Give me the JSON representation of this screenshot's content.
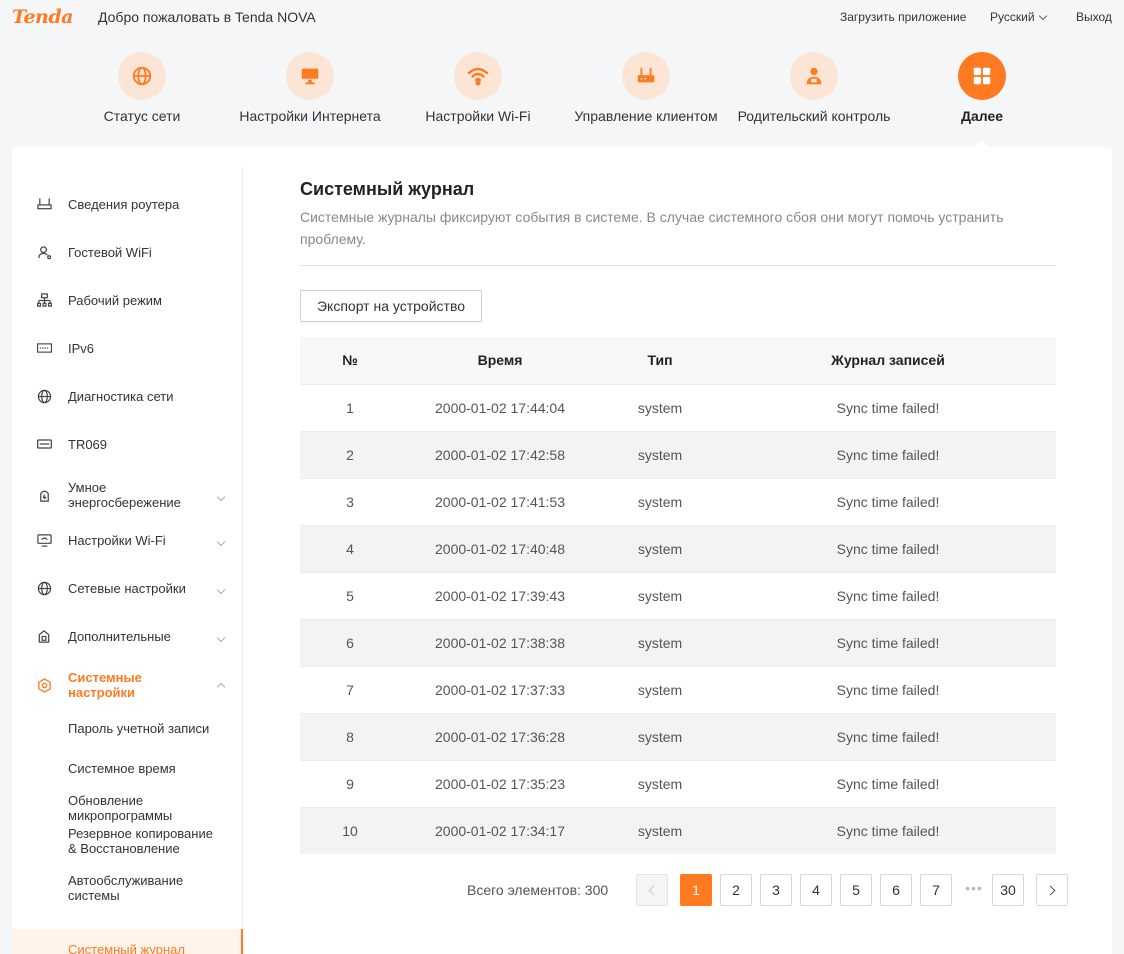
{
  "header": {
    "logo": "Tenda",
    "welcome": "Добро пожаловать в Tenda NOVA",
    "download_app": "Загрузить приложение",
    "language": "Русский",
    "logout": "Выход"
  },
  "topnav": {
    "items": [
      {
        "label": "Статус сети",
        "icon": "globe-icon"
      },
      {
        "label": "Настройки Интернета",
        "icon": "monitor-icon"
      },
      {
        "label": "Настройки Wi-Fi",
        "icon": "wifi-icon"
      },
      {
        "label": "Управление клиентом",
        "icon": "router-icon"
      },
      {
        "label": "Родительский контроль",
        "icon": "parent-icon"
      },
      {
        "label": "Далее",
        "icon": "grid-icon",
        "active": true
      }
    ]
  },
  "sidebar": {
    "items": [
      {
        "label": "Сведения роутера",
        "icon": "router-info-icon"
      },
      {
        "label": "Гостевой WiFi",
        "icon": "guest-icon"
      },
      {
        "label": "Рабочий режим",
        "icon": "mode-icon"
      },
      {
        "label": "IPv6",
        "icon": "ipv6-icon"
      },
      {
        "label": "Диагностика сети",
        "icon": "globe-icon"
      },
      {
        "label": "TR069",
        "icon": "tr069-icon"
      },
      {
        "label": "Умное энергосбережение",
        "icon": "power-icon",
        "expandable": true
      },
      {
        "label": "Настройки Wi-Fi",
        "icon": "wifi-settings-icon",
        "expandable": true
      },
      {
        "label": "Сетевые настройки",
        "icon": "globe-icon",
        "expandable": true
      },
      {
        "label": "Дополнительные",
        "icon": "lock-icon",
        "expandable": true
      },
      {
        "label": "Системные настройки",
        "icon": "gear-icon",
        "expandable": true,
        "expanded": true
      }
    ],
    "subitems": [
      {
        "label": "Пароль учетной записи"
      },
      {
        "label": "Системное время"
      },
      {
        "label": "Обновление микропрограммы"
      },
      {
        "label": "Резервное копирование & Восстановление"
      },
      {
        "label": "Автообслуживание системы"
      },
      {
        "label": "Системный журнал",
        "active": true
      }
    ]
  },
  "content": {
    "title": "Системный журнал",
    "description": "Системные журналы фиксируют события в системе. В случае системного сбоя они могут помочь устранить проблему.",
    "export_button": "Экспорт на устройство",
    "table": {
      "headers": [
        "№",
        "Время",
        "Тип",
        "Журнал записей"
      ],
      "rows": [
        [
          "1",
          "2000-01-02 17:44:04",
          "system",
          "Sync time failed!"
        ],
        [
          "2",
          "2000-01-02 17:42:58",
          "system",
          "Sync time failed!"
        ],
        [
          "3",
          "2000-01-02 17:41:53",
          "system",
          "Sync time failed!"
        ],
        [
          "4",
          "2000-01-02 17:40:48",
          "system",
          "Sync time failed!"
        ],
        [
          "5",
          "2000-01-02 17:39:43",
          "system",
          "Sync time failed!"
        ],
        [
          "6",
          "2000-01-02 17:38:38",
          "system",
          "Sync time failed!"
        ],
        [
          "7",
          "2000-01-02 17:37:33",
          "system",
          "Sync time failed!"
        ],
        [
          "8",
          "2000-01-02 17:36:28",
          "system",
          "Sync time failed!"
        ],
        [
          "9",
          "2000-01-02 17:35:23",
          "system",
          "Sync time failed!"
        ],
        [
          "10",
          "2000-01-02 17:34:17",
          "system",
          "Sync time failed!"
        ]
      ]
    },
    "pagination": {
      "total_label": "Всего элементов: 300",
      "pages": [
        "1",
        "2",
        "3",
        "4",
        "5",
        "6",
        "7"
      ],
      "ellipsis": "•••",
      "last_page": "30",
      "current": "1"
    }
  },
  "colors": {
    "accent": "#ff7a21",
    "accent_light": "#fde5d6"
  }
}
